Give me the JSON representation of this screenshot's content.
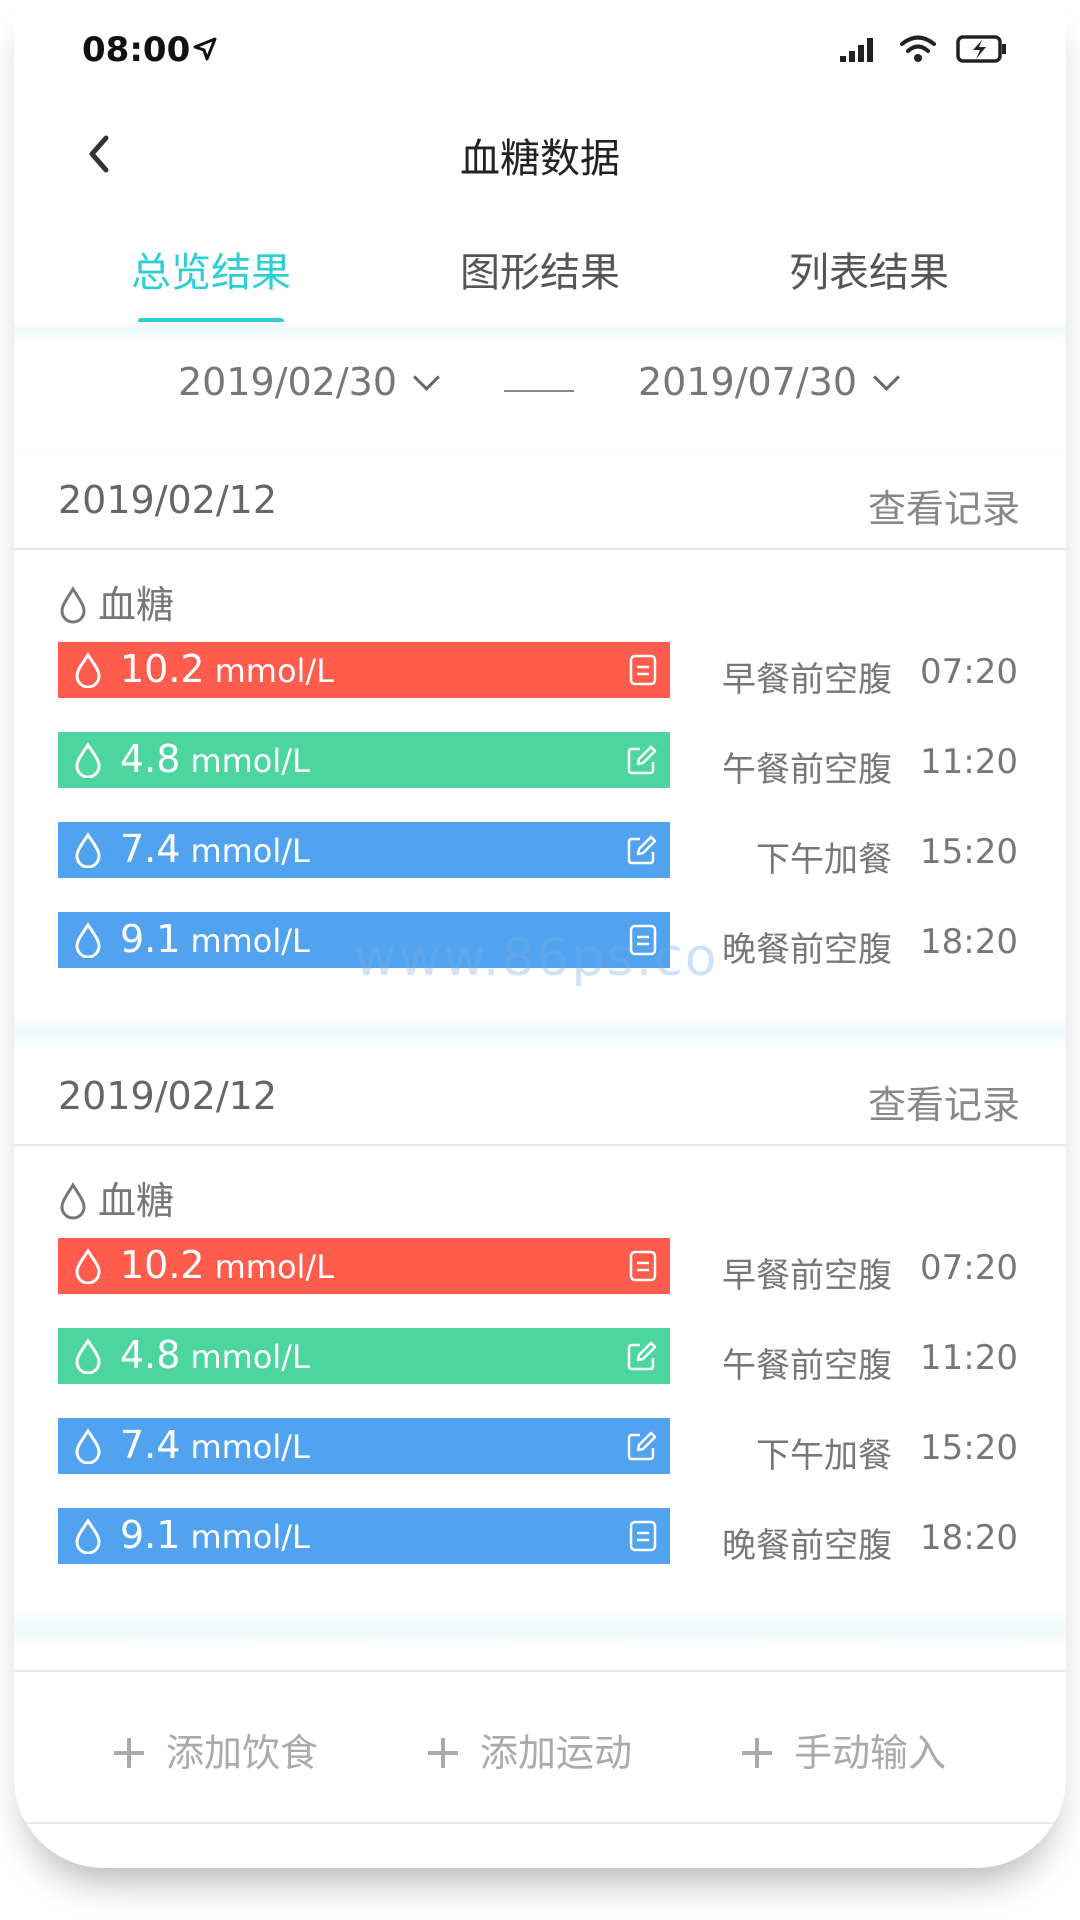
{
  "status": {
    "time": "08:00"
  },
  "nav": {
    "title": "血糖数据"
  },
  "tabs": [
    {
      "label": "总览结果"
    },
    {
      "label": "图形结果"
    },
    {
      "label": "列表结果"
    }
  ],
  "range": {
    "start": "2019/02/30",
    "end": "2019/07/30"
  },
  "colors": {
    "accent": "#2ecfd4",
    "high": "#ff5c4d",
    "normal": "#4cd59f",
    "elevated": "#51a3f0"
  },
  "cards": [
    {
      "date": "2019/02/12",
      "view_label": "查看记录",
      "section": "血糖",
      "rows": [
        {
          "value": "10.2",
          "unit": "mmol/L",
          "meal": "早餐前空腹",
          "time": "07:20",
          "level": "high",
          "icon": "record-icon"
        },
        {
          "value": "4.8",
          "unit": "mmol/L",
          "meal": "午餐前空腹",
          "time": "11:20",
          "level": "normal",
          "icon": "edit-icon"
        },
        {
          "value": "7.4",
          "unit": "mmol/L",
          "meal": "下午加餐",
          "time": "15:20",
          "level": "elevated",
          "icon": "edit-icon"
        },
        {
          "value": "9.1",
          "unit": "mmol/L",
          "meal": "晚餐前空腹",
          "time": "18:20",
          "level": "elevated",
          "icon": "record-icon"
        }
      ]
    },
    {
      "date": "2019/02/12",
      "view_label": "查看记录",
      "section": "血糖",
      "rows": [
        {
          "value": "10.2",
          "unit": "mmol/L",
          "meal": "早餐前空腹",
          "time": "07:20",
          "level": "high",
          "icon": "record-icon"
        },
        {
          "value": "4.8",
          "unit": "mmol/L",
          "meal": "午餐前空腹",
          "time": "11:20",
          "level": "normal",
          "icon": "edit-icon"
        },
        {
          "value": "7.4",
          "unit": "mmol/L",
          "meal": "下午加餐",
          "time": "15:20",
          "level": "elevated",
          "icon": "edit-icon"
        },
        {
          "value": "9.1",
          "unit": "mmol/L",
          "meal": "晚餐前空腹",
          "time": "18:20",
          "level": "elevated",
          "icon": "record-icon"
        }
      ]
    }
  ],
  "actions": [
    {
      "label": "添加饮食"
    },
    {
      "label": "添加运动"
    },
    {
      "label": "手动输入"
    }
  ],
  "watermark": "www.86ps.co"
}
